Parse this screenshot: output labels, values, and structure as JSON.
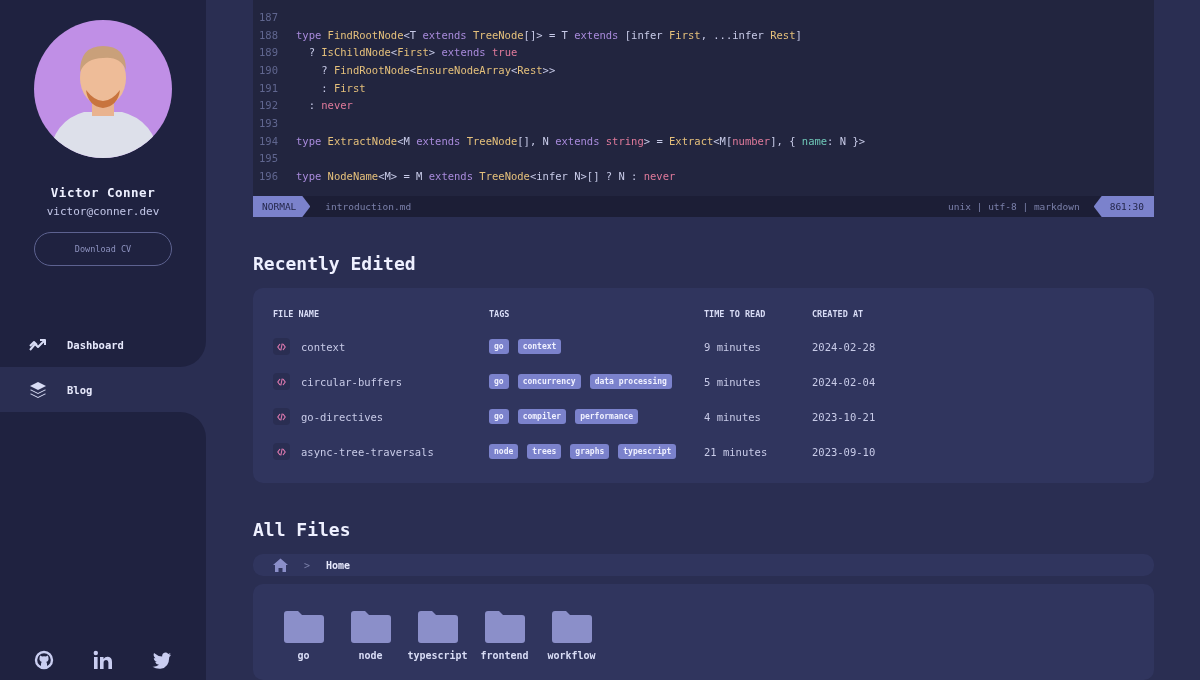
{
  "sidebar": {
    "profile": {
      "name": "Victor Conner",
      "email": "victor@conner.dev",
      "button": "Download CV"
    },
    "nav": [
      {
        "label": "Dashboard",
        "kind": "trend",
        "selected": false
      },
      {
        "label": "Blog",
        "kind": "layers",
        "selected": true
      }
    ],
    "social": [
      {
        "kind": "github"
      },
      {
        "kind": "linkedin"
      },
      {
        "kind": "twitter"
      }
    ]
  },
  "editor": {
    "lines": [
      {
        "number": "187"
      },
      {
        "number": "188",
        "tokens": [
          {
            "t": "type ",
            "kind": "keyword"
          },
          {
            "t": "FindRootNode",
            "kind": "type"
          },
          {
            "t": "<T ",
            "kind": "plain"
          },
          {
            "t": "extends ",
            "kind": "keyword"
          },
          {
            "t": "TreeNode",
            "kind": "type"
          },
          {
            "t": "[]> = T ",
            "kind": "plain"
          },
          {
            "t": "extends",
            "kind": "keyword"
          },
          {
            "t": " [infer ",
            "kind": "plain"
          },
          {
            "t": "First",
            "kind": "type"
          },
          {
            "t": ", ...infer ",
            "kind": "plain"
          },
          {
            "t": "Rest",
            "kind": "type"
          },
          {
            "t": "]",
            "kind": "plain"
          }
        ]
      },
      {
        "number": "189",
        "tokens": [
          {
            "t": "  ? ",
            "kind": "plain"
          },
          {
            "t": "IsChildNode",
            "kind": "type"
          },
          {
            "t": "<",
            "kind": "plain"
          },
          {
            "t": "First",
            "kind": "type"
          },
          {
            "t": "> ",
            "kind": "plain"
          },
          {
            "t": "extends ",
            "kind": "keyword"
          },
          {
            "t": "true",
            "kind": "literal"
          }
        ]
      },
      {
        "number": "190",
        "tokens": [
          {
            "t": "    ? ",
            "kind": "plain"
          },
          {
            "t": "FindRootNode",
            "kind": "type"
          },
          {
            "t": "<",
            "kind": "plain"
          },
          {
            "t": "EnsureNodeArray",
            "kind": "type"
          },
          {
            "t": "<",
            "kind": "plain"
          },
          {
            "t": "Rest",
            "kind": "type"
          },
          {
            "t": ">>",
            "kind": "plain"
          }
        ]
      },
      {
        "number": "191",
        "tokens": [
          {
            "t": "    : ",
            "kind": "plain"
          },
          {
            "t": "First",
            "kind": "type"
          }
        ]
      },
      {
        "number": "192",
        "tokens": [
          {
            "t": "  : ",
            "kind": "plain"
          },
          {
            "t": "never",
            "kind": "literal"
          }
        ]
      },
      {
        "number": "193"
      },
      {
        "number": "194",
        "tokens": [
          {
            "t": "type ",
            "kind": "keyword"
          },
          {
            "t": "ExtractNode",
            "kind": "type"
          },
          {
            "t": "<M ",
            "kind": "plain"
          },
          {
            "t": "extends ",
            "kind": "keyword"
          },
          {
            "t": "TreeNode",
            "kind": "type"
          },
          {
            "t": "[], N ",
            "kind": "plain"
          },
          {
            "t": "extends ",
            "kind": "keyword"
          },
          {
            "t": "string",
            "kind": "literal"
          },
          {
            "t": "> = ",
            "kind": "plain"
          },
          {
            "t": "Extract",
            "kind": "type"
          },
          {
            "t": "<M[",
            "kind": "plain"
          },
          {
            "t": "number",
            "kind": "literal"
          },
          {
            "t": "], { ",
            "kind": "plain"
          },
          {
            "t": "name",
            "kind": "property"
          },
          {
            "t": ": N }>",
            "kind": "plain"
          }
        ]
      },
      {
        "number": "195"
      },
      {
        "number": "196",
        "tokens": [
          {
            "t": "type ",
            "kind": "keyword"
          },
          {
            "t": "NodeName",
            "kind": "type"
          },
          {
            "t": "<M> = M ",
            "kind": "plain"
          },
          {
            "t": "extends ",
            "kind": "keyword"
          },
          {
            "t": "TreeNode",
            "kind": "type"
          },
          {
            "t": "<infer N>[] ? N : ",
            "kind": "plain"
          },
          {
            "t": "never",
            "kind": "literal"
          }
        ]
      }
    ],
    "status_bar": {
      "mode": "NORMAL",
      "file": "introduction.md",
      "info": "unix | utf-8 | markdown",
      "position": "861:30"
    }
  },
  "recently_edited": {
    "title": "Recently Edited",
    "columns": [
      "FILE NAME",
      "TAGS",
      "TIME TO READ",
      "CREATED AT"
    ],
    "rows": [
      {
        "name": "context",
        "tags": [
          "go",
          "context"
        ],
        "time": "9 minutes",
        "created": "2024-02-28"
      },
      {
        "name": "circular-buffers",
        "tags": [
          "go",
          "concurrency",
          "data processing"
        ],
        "time": "5 minutes",
        "created": "2024-02-04"
      },
      {
        "name": "go-directives",
        "tags": [
          "go",
          "compiler",
          "performance"
        ],
        "time": "4 minutes",
        "created": "2023-10-21"
      },
      {
        "name": "async-tree-traversals",
        "tags": [
          "node",
          "trees",
          "graphs",
          "typescript"
        ],
        "time": "21 minutes",
        "created": "2023-09-10"
      }
    ]
  },
  "all_files": {
    "title": "All Files",
    "breadcrumb": {
      "separator": ">",
      "current": "Home"
    },
    "folders": [
      {
        "name": "go"
      },
      {
        "name": "node"
      },
      {
        "name": "typescript"
      },
      {
        "name": "frontend"
      },
      {
        "name": "workflow"
      }
    ]
  }
}
